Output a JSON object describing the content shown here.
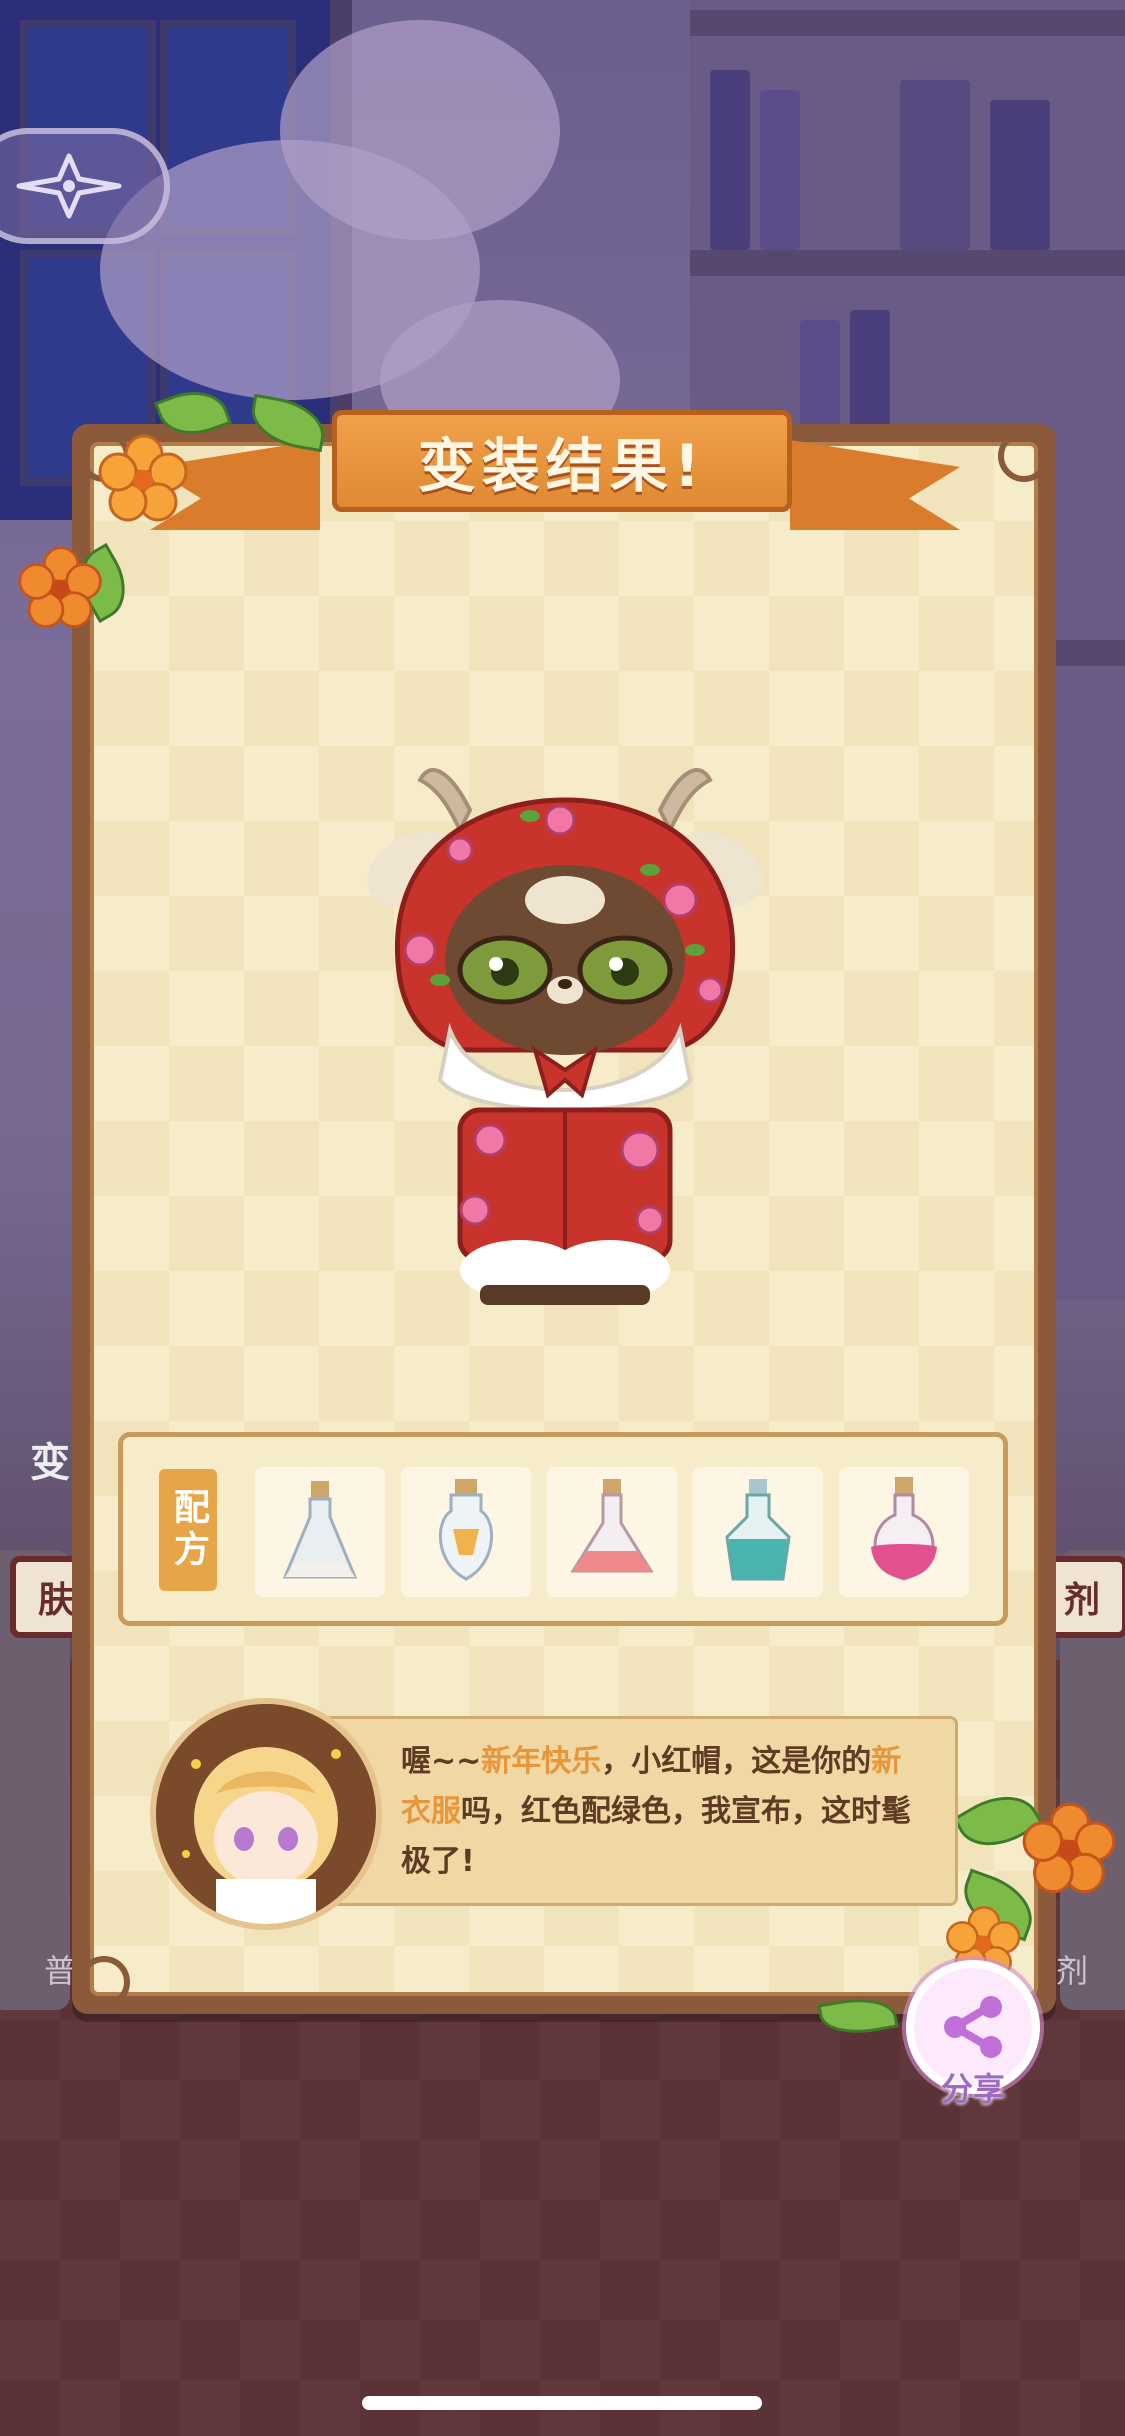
{
  "title": "变装结果!",
  "recipe": {
    "label": "配方",
    "potions": [
      {
        "icon": "clear-potion-icon",
        "color": "#dfe8ef"
      },
      {
        "icon": "amber-potion-icon",
        "color": "#f0b24a"
      },
      {
        "icon": "pink-orange-potion-icon",
        "color": "#f08a8a"
      },
      {
        "icon": "teal-potion-icon",
        "color": "#49b3ad"
      },
      {
        "icon": "magenta-potion-icon",
        "color": "#e2508e"
      }
    ]
  },
  "dialogue": {
    "prefix": "喔~~",
    "highlight1": "新年快乐",
    "mid": "，小红帽，这是你的",
    "highlight2": "新衣服",
    "suffix": "吗，红色配绿色，我宣布，这时髦极了!"
  },
  "share": {
    "label": "分享"
  },
  "background": {
    "side_left_chip": "肤",
    "side_right_chip": "剂",
    "side_left_bottom": "普",
    "side_right_bottom": "剂",
    "side_left_mid": "变"
  },
  "colors": {
    "accent": "#e08a33",
    "frame": "#8a5a3a",
    "card_bg": "#f7ecc9",
    "highlight_text": "#e8963a"
  }
}
